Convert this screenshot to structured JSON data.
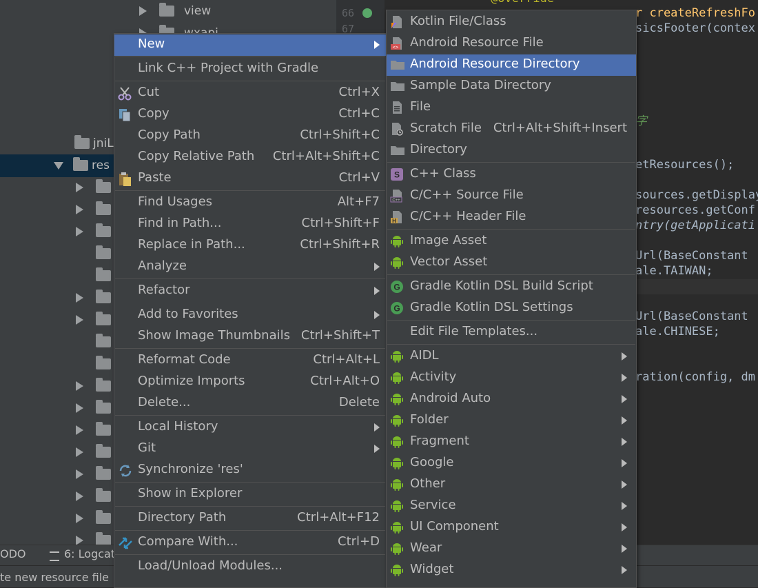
{
  "colors": {
    "menu_bg": "#3c3f41",
    "selection": "#4b6eaf",
    "tree_selection": "#0d293e",
    "android_green": "#7ab62a",
    "code_orange": "#cc7832",
    "code_yellow": "#ffc66d",
    "code_purple": "#9876aa"
  },
  "tree": {
    "items": [
      {
        "label": "view",
        "arrow": "right",
        "indent": 1
      },
      {
        "label": "wxapi",
        "arrow": "right",
        "indent": 1
      },
      {
        "label": "jniL",
        "arrow": "none",
        "indent": 0
      },
      {
        "label": "res",
        "arrow": "down",
        "indent": 0
      }
    ]
  },
  "editor": {
    "line_numbers": [
      "66",
      "67"
    ],
    "lines": [
      {
        "text": "@Override",
        "color": "#bbb529"
      },
      {
        "text": "r createRefreshFo",
        "color": "#ffc66d"
      },
      {
        "text": "sicsFooter(contex",
        "color": "#a9b7c6"
      },
      {
        "text": "字",
        "color": "#629755"
      },
      {
        "text": "etResources();",
        "color": "#a9b7c6"
      },
      {
        "text": "sources.getDisplay",
        "color": "#a9b7c6"
      },
      {
        "text": "resources.getConf",
        "color": "#a9b7c6"
      },
      {
        "text": "ntry(getApplicati",
        "color": "#a9b7c6"
      },
      {
        "text": "Url(BaseConstant",
        "color": "#a9b7c6"
      },
      {
        "text": "ale.TAIWAN;",
        "color": "#a9b7c6"
      },
      {
        "text": "Url(BaseConstant",
        "color": "#a9b7c6"
      },
      {
        "text": "ale.CHINESE;",
        "color": "#a9b7c6"
      },
      {
        "text": "ration(config, dm",
        "color": "#a9b7c6"
      }
    ]
  },
  "bottom_tabs": [
    {
      "label": "ODO"
    },
    {
      "label": "6: Logcat"
    }
  ],
  "status_text": "te new resource file",
  "context_menu": {
    "items": [
      {
        "label": "New",
        "shortcut": "",
        "submenu": true,
        "selected": true,
        "icon": ""
      },
      {
        "label": "Link C++ Project with Gradle",
        "shortcut": "",
        "submenu": false,
        "icon": ""
      },
      {
        "label": "Cut",
        "shortcut": "Ctrl+X",
        "submenu": false,
        "icon": "scissors-icon"
      },
      {
        "label": "Copy",
        "shortcut": "Ctrl+C",
        "submenu": false,
        "icon": "copy-icon"
      },
      {
        "label": "Copy Path",
        "shortcut": "Ctrl+Shift+C",
        "submenu": false,
        "icon": ""
      },
      {
        "label": "Copy Relative Path",
        "shortcut": "Ctrl+Alt+Shift+C",
        "submenu": false,
        "icon": ""
      },
      {
        "label": "Paste",
        "shortcut": "Ctrl+V",
        "submenu": false,
        "icon": "paste-icon"
      },
      {
        "label": "Find Usages",
        "shortcut": "Alt+F7",
        "submenu": false,
        "icon": ""
      },
      {
        "label": "Find in Path...",
        "shortcut": "Ctrl+Shift+F",
        "submenu": false,
        "icon": ""
      },
      {
        "label": "Replace in Path...",
        "shortcut": "Ctrl+Shift+R",
        "submenu": false,
        "icon": ""
      },
      {
        "label": "Analyze",
        "shortcut": "",
        "submenu": true,
        "icon": ""
      },
      {
        "label": "Refactor",
        "shortcut": "",
        "submenu": true,
        "icon": ""
      },
      {
        "label": "Add to Favorites",
        "shortcut": "",
        "submenu": true,
        "icon": ""
      },
      {
        "label": "Show Image Thumbnails",
        "shortcut": "Ctrl+Shift+T",
        "submenu": false,
        "icon": ""
      },
      {
        "label": "Reformat Code",
        "shortcut": "Ctrl+Alt+L",
        "submenu": false,
        "icon": ""
      },
      {
        "label": "Optimize Imports",
        "shortcut": "Ctrl+Alt+O",
        "submenu": false,
        "icon": ""
      },
      {
        "label": "Delete...",
        "shortcut": "Delete",
        "submenu": false,
        "icon": ""
      },
      {
        "label": "Local History",
        "shortcut": "",
        "submenu": true,
        "icon": ""
      },
      {
        "label": "Git",
        "shortcut": "",
        "submenu": true,
        "icon": ""
      },
      {
        "label": "Synchronize 'res'",
        "shortcut": "",
        "submenu": false,
        "icon": "sync-icon"
      },
      {
        "label": "Show in Explorer",
        "shortcut": "",
        "submenu": false,
        "icon": ""
      },
      {
        "label": "Directory Path",
        "shortcut": "Ctrl+Alt+F12",
        "submenu": false,
        "icon": ""
      },
      {
        "label": "Compare With...",
        "shortcut": "Ctrl+D",
        "submenu": false,
        "icon": "compare-icon"
      },
      {
        "label": "Load/Unload Modules...",
        "shortcut": "",
        "submenu": false,
        "icon": ""
      }
    ]
  },
  "new_submenu": {
    "items": [
      {
        "label": "Kotlin File/Class",
        "shortcut": "",
        "submenu": false,
        "icon": "kotlin-file-icon"
      },
      {
        "label": "Android Resource File",
        "shortcut": "",
        "submenu": false,
        "icon": "resource-file-icon"
      },
      {
        "label": "Android Resource Directory",
        "shortcut": "",
        "submenu": false,
        "selected": true,
        "icon": "folder-icon"
      },
      {
        "label": "Sample Data Directory",
        "shortcut": "",
        "submenu": false,
        "icon": "folder-icon"
      },
      {
        "label": "File",
        "shortcut": "",
        "submenu": false,
        "icon": "file-icon"
      },
      {
        "label": "Scratch File",
        "shortcut": "Ctrl+Alt+Shift+Insert",
        "submenu": false,
        "icon": "scratch-file-icon"
      },
      {
        "label": "Directory",
        "shortcut": "",
        "submenu": false,
        "icon": "folder-icon"
      },
      {
        "label": "C++ Class",
        "shortcut": "",
        "submenu": false,
        "icon": "cpp-class-icon"
      },
      {
        "label": "C/C++ Source File",
        "shortcut": "",
        "submenu": false,
        "icon": "cpp-source-icon"
      },
      {
        "label": "C/C++ Header File",
        "shortcut": "",
        "submenu": false,
        "icon": "cpp-header-icon"
      },
      {
        "label": "Image Asset",
        "shortcut": "",
        "submenu": false,
        "icon": "android-icon"
      },
      {
        "label": "Vector Asset",
        "shortcut": "",
        "submenu": false,
        "icon": "android-icon"
      },
      {
        "label": "Gradle Kotlin DSL Build Script",
        "shortcut": "",
        "submenu": false,
        "icon": "gradle-icon"
      },
      {
        "label": "Gradle Kotlin DSL Settings",
        "shortcut": "",
        "submenu": false,
        "icon": "gradle-icon"
      },
      {
        "label": "Edit File Templates...",
        "shortcut": "",
        "submenu": false,
        "icon": ""
      },
      {
        "label": "AIDL",
        "shortcut": "",
        "submenu": true,
        "icon": "android-icon"
      },
      {
        "label": "Activity",
        "shortcut": "",
        "submenu": true,
        "icon": "android-icon"
      },
      {
        "label": "Android Auto",
        "shortcut": "",
        "submenu": true,
        "icon": "android-icon"
      },
      {
        "label": "Folder",
        "shortcut": "",
        "submenu": true,
        "icon": "android-icon"
      },
      {
        "label": "Fragment",
        "shortcut": "",
        "submenu": true,
        "icon": "android-icon"
      },
      {
        "label": "Google",
        "shortcut": "",
        "submenu": true,
        "icon": "android-icon"
      },
      {
        "label": "Other",
        "shortcut": "",
        "submenu": true,
        "icon": "android-icon"
      },
      {
        "label": "Service",
        "shortcut": "",
        "submenu": true,
        "icon": "android-icon"
      },
      {
        "label": "UI Component",
        "shortcut": "",
        "submenu": true,
        "icon": "android-icon"
      },
      {
        "label": "Wear",
        "shortcut": "",
        "submenu": true,
        "icon": "android-icon"
      },
      {
        "label": "Widget",
        "shortcut": "",
        "submenu": true,
        "icon": "android-icon"
      }
    ]
  }
}
